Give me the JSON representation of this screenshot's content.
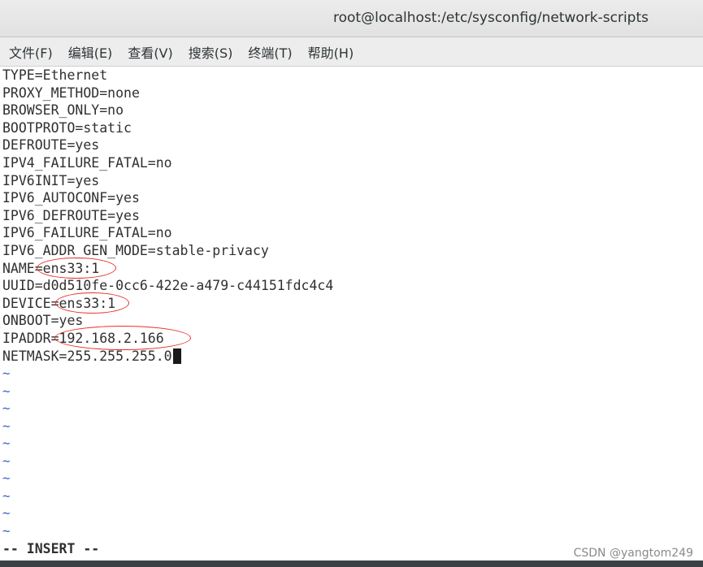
{
  "window": {
    "title": "root@localhost:/etc/sysconfig/network-scripts"
  },
  "menu": [
    {
      "label": "文件(F)"
    },
    {
      "label": "编辑(E)"
    },
    {
      "label": "查看(V)"
    },
    {
      "label": "搜索(S)"
    },
    {
      "label": "终端(T)"
    },
    {
      "label": "帮助(H)"
    }
  ],
  "file_lines": [
    "TYPE=Ethernet",
    "PROXY_METHOD=none",
    "BROWSER_ONLY=no",
    "BOOTPROTO=static",
    "DEFROUTE=yes",
    "IPV4_FAILURE_FATAL=no",
    "IPV6INIT=yes",
    "IPV6_AUTOCONF=yes",
    "IPV6_DEFROUTE=yes",
    "IPV6_FAILURE_FATAL=no",
    "IPV6_ADDR_GEN_MODE=stable-privacy",
    "NAME=ens33:1",
    "UUID=d0d510fe-0cc6-422e-a479-c44151fdc4c4",
    "DEVICE=ens33:1",
    "ONBOOT=yes",
    "IPADDR=192.168.2.166",
    "NETMASK=255.255.255.0"
  ],
  "empty_line_marker": "~",
  "status": {
    "mode": "-- INSERT --"
  },
  "watermark": "CSDN @yangtom249",
  "colors": {
    "annotation": "#e8302a",
    "tilde": "#3a5fcd"
  }
}
